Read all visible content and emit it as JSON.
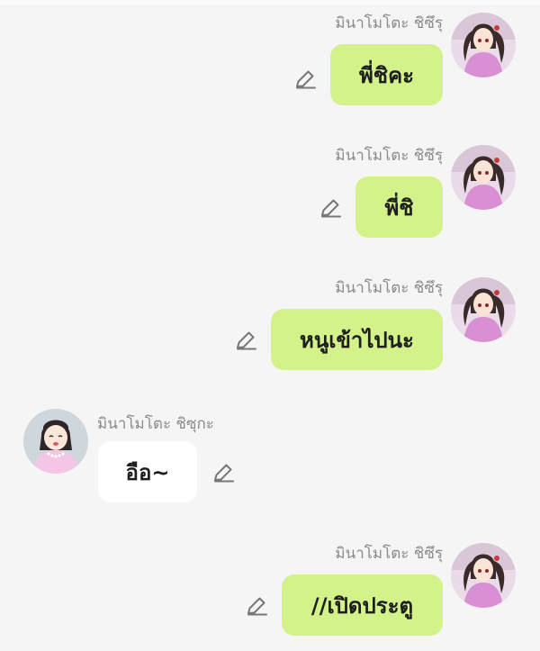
{
  "messages": [
    {
      "direction": "out",
      "sender": "มินาโมโตะ ชิซึรุ",
      "text": "พี่ชิคะ"
    },
    {
      "direction": "out",
      "sender": "มินาโมโตะ ชิซึรุ",
      "text": "พี่ชิ"
    },
    {
      "direction": "out",
      "sender": "มินาโมโตะ ชิซึรุ",
      "text": "หนูเข้าไปนะ"
    },
    {
      "direction": "in",
      "sender": "มินาโมโตะ ชิซุกะ",
      "text": "อือ~"
    },
    {
      "direction": "out",
      "sender": "มินาโมโตะ ชิซึรุ",
      "text": "//เปิดประตู"
    }
  ],
  "colors": {
    "background": "#f5f5f5",
    "outgoing_bubble": "#d3f28a",
    "incoming_bubble": "#ffffff",
    "sender_name": "#8a8a8a",
    "edit_icon": "#777777"
  },
  "icons": {
    "edit": "pencil-edit-icon",
    "avatar_out": "girl-twin-tails-avatar",
    "avatar_in": "girl-pink-dress-avatar"
  }
}
